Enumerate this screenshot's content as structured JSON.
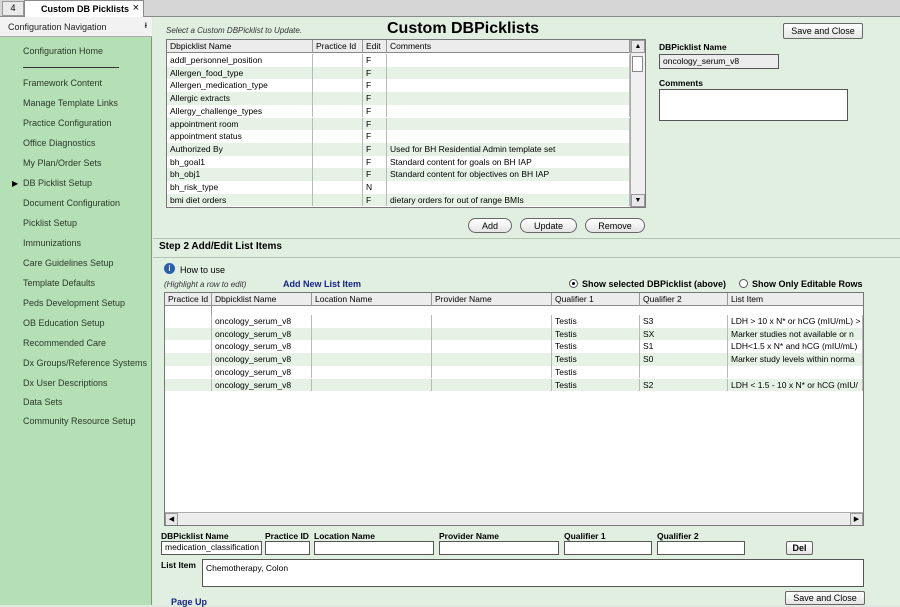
{
  "tab": {
    "nav_glyph": "4",
    "label": "Custom DB Picklists",
    "close_glyph": "×"
  },
  "sidebar": {
    "title": "Configuration Navigation",
    "pin_glyph": "ᵻ",
    "items": [
      "Configuration Home",
      "Framework Content",
      "Manage Template Links",
      "Practice Configuration",
      "Office Diagnostics",
      "My Plan/Order Sets",
      "DB Picklist Setup",
      "Document Configuration",
      "Picklist Setup",
      "Immunizations",
      "Care Guidelines Setup",
      "Template Defaults",
      "Peds Development Setup",
      "OB Education Setup",
      "Recommended Care",
      "Dx Groups/Reference Systems",
      "Dx User Descriptions",
      "Data Sets",
      "Community Resource Setup"
    ],
    "current_arrow": "▶"
  },
  "step1": {
    "hint": "Select a Custom DBPicklist to Update.",
    "title": "Custom DBPicklists",
    "save_close": "Save and Close",
    "columns": [
      "Dbpicklist Name",
      "Practice Id",
      "Edit",
      "Comments"
    ],
    "rows": [
      [
        "addl_personnel_position",
        "",
        "F",
        ""
      ],
      [
        "Allergen_food_type",
        "",
        "F",
        ""
      ],
      [
        "Allergen_medication_type",
        "",
        "F",
        ""
      ],
      [
        "Allergic extracts",
        "",
        "F",
        ""
      ],
      [
        "Allergy_challenge_types",
        "",
        "F",
        ""
      ],
      [
        "appointment room",
        "",
        "F",
        ""
      ],
      [
        "appointment status",
        "",
        "F",
        ""
      ],
      [
        "Authorized By",
        "",
        "F",
        "Used for BH Residential Admin template set"
      ],
      [
        "bh_goal1",
        "",
        "F",
        "Standard content for goals on BH IAP"
      ],
      [
        "bh_obj1",
        "",
        "F",
        "Standard content for objectives on BH IAP"
      ],
      [
        "bh_risk_type",
        "",
        "N",
        ""
      ],
      [
        "bmi diet orders",
        "",
        "F",
        "dietary orders for out of range BMIs"
      ]
    ],
    "name_label": "DBPicklist Name",
    "name_value": "oncology_serum_v8",
    "comments_label": "Comments",
    "comments_value": "",
    "add": "Add",
    "update": "Update",
    "remove": "Remove",
    "scroll_up": "▲",
    "scroll_down": "▼"
  },
  "step2": {
    "title": "Step 2 Add/Edit List Items",
    "how_to_use": "How to use",
    "info_glyph": "i",
    "highlight_hint": "(Highlight a row to edit)",
    "add_new": "Add New List Item",
    "radio_show_selected": "Show selected DBPicklist (above)",
    "radio_show_editable": "Show Only Editable Rows",
    "columns": [
      "Practice Id",
      "Dbpicklist Name",
      "Location Name",
      "Provider Name",
      "Qualifier 1",
      "Qualifier 2",
      "List Item"
    ],
    "rows": [
      [
        "",
        "oncology_serum_v8",
        "",
        "",
        "Testis",
        "S3",
        "LDH > 10 x N* or hCG (mIU/mL) >"
      ],
      [
        "",
        "oncology_serum_v8",
        "",
        "",
        "Testis",
        "SX",
        "Marker studies not available or n"
      ],
      [
        "",
        "oncology_serum_v8",
        "",
        "",
        "Testis",
        "S1",
        "LDH<1.5 x N* and hCG (mIU/mL)"
      ],
      [
        "",
        "oncology_serum_v8",
        "",
        "",
        "Testis",
        "S0",
        "Marker study levels within norma"
      ],
      [
        "",
        "oncology_serum_v8",
        "",
        "",
        "Testis",
        "",
        ""
      ],
      [
        "",
        "oncology_serum_v8",
        "",
        "",
        "Testis",
        "S2",
        "LDH < 1.5 - 10 x N* or hCG (mIU/"
      ]
    ],
    "scroll_left": "◀",
    "scroll_right": "▶",
    "form": {
      "dbpicklist_label": "DBPicklist Name",
      "dbpicklist_value": "medication_classification",
      "practice_label": "Practice ID",
      "practice_value": "",
      "location_label": "Location Name",
      "location_value": "",
      "provider_label": "Provider Name",
      "provider_value": "",
      "q1_label": "Qualifier 1",
      "q1_value": "",
      "q2_label": "Qualifier 2",
      "q2_value": "",
      "del": "Del",
      "list_item_label": "List Item",
      "list_item_value": "Chemotherapy, Colon"
    },
    "page_up": "Page Up",
    "save_close": "Save and Close"
  }
}
